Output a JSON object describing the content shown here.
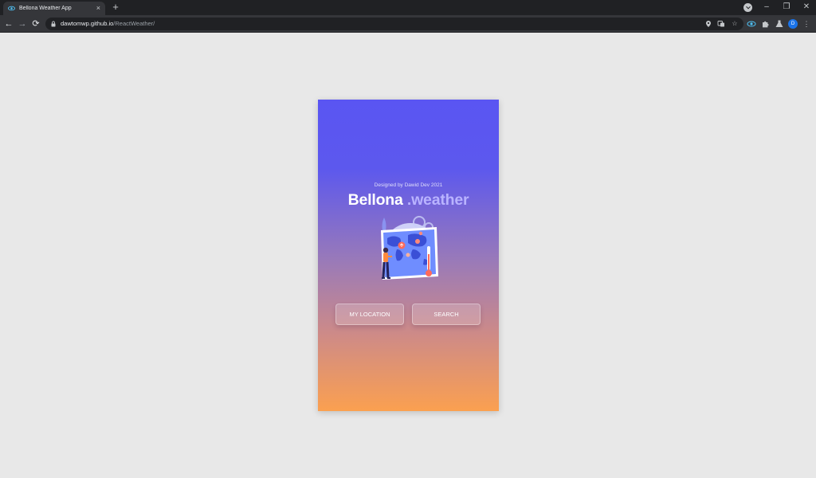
{
  "browser": {
    "tab_title": "Bellona Weather App",
    "tab_close": "×",
    "new_tab": "+",
    "url_host": "dawtomwp.github.io",
    "url_path": "/ReactWeather/",
    "profile_initial": "D",
    "icons": {
      "back": "←",
      "forward": "→",
      "reload": "⟳",
      "location": "location-pin-icon",
      "translate": "translate-icon",
      "bookmark": "☆",
      "extension_eye": "eye-extension-icon",
      "extensions": "puzzle-icon",
      "flask": "flask-icon",
      "menu": "⋮"
    },
    "window": {
      "minimize": "–",
      "restore": "❐",
      "close": "✕"
    }
  },
  "app": {
    "designer": "Designed by Dawid Dev 2021",
    "brand_main": "Bellona",
    "brand_sub": " .weather",
    "buttons": {
      "my_location": "MY LOCATION",
      "search": "SEARCH"
    },
    "colors": {
      "gradient_top": "#5a55f2",
      "gradient_mid": "#9a7ab8",
      "gradient_bottom": "#fba050",
      "brand_sub": "#b9b3ff"
    }
  }
}
